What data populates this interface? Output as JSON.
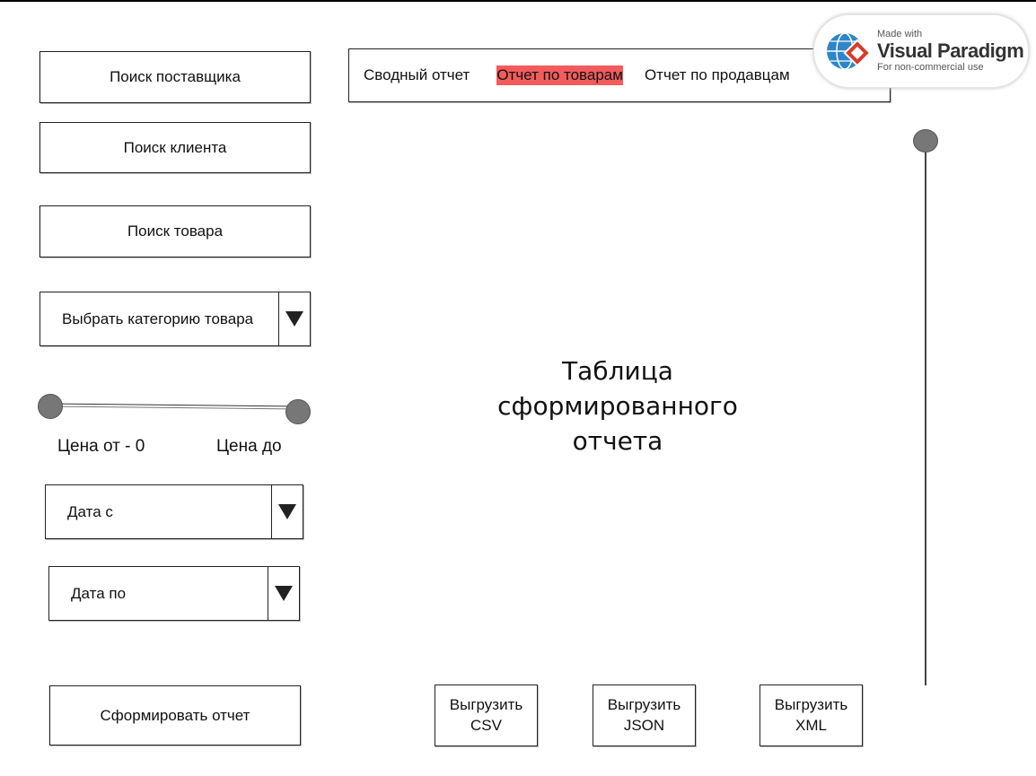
{
  "sidebar": {
    "search_supplier": "Поиск поставщика",
    "search_client": "Поиск клиента",
    "search_product": "Поиск товара",
    "category_select": "Выбрать категорию товара",
    "price_from": "Цена от - 0",
    "price_to": "Цена до",
    "date_from": "Дата с",
    "date_to": "Дата по",
    "generate_button": "Сформировать отчет"
  },
  "tabs": [
    {
      "label": "Сводный отчет",
      "active": false
    },
    {
      "label": "Отчет по товарам",
      "active": true
    },
    {
      "label": "Отчет по продавцам",
      "active": false
    }
  ],
  "main": {
    "table_placeholder_line1": "Таблица",
    "table_placeholder_line2": "сформированного",
    "table_placeholder_line3": "отчета"
  },
  "export": {
    "csv_line1": "Выгрузить",
    "csv_line2": "CSV",
    "json_line1": "Выгрузить",
    "json_line2": "JSON",
    "xml_line1": "Выгрузить",
    "xml_line2": "XML"
  },
  "watermark": {
    "made_with": "Made with",
    "brand": "Visual Paradigm",
    "sub": "For non-commercial use"
  },
  "colors": {
    "active_tab": "#f25c5c",
    "knob": "#777777"
  },
  "icons": {
    "dropdown": "triangle-down-icon",
    "watermark_logo": "visual-paradigm-logo"
  }
}
